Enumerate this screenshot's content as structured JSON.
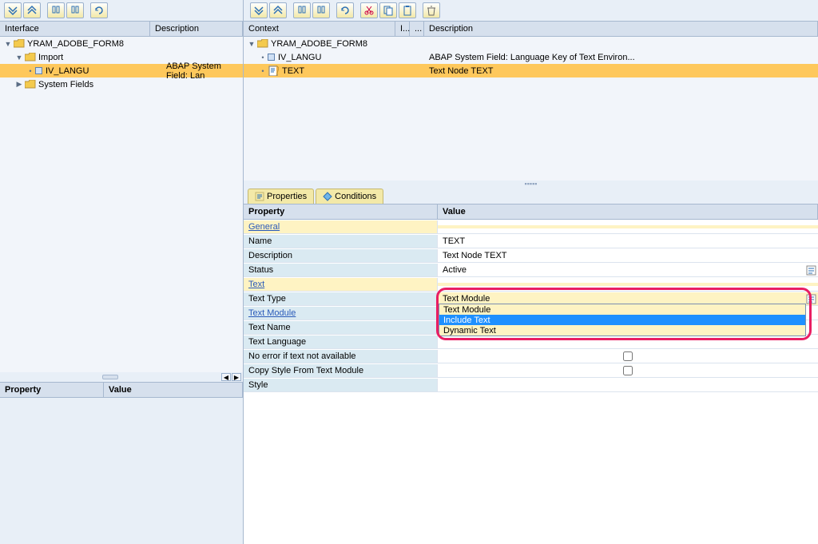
{
  "leftToolbar": {
    "tips": [
      "expand-all",
      "collapse-all",
      "find",
      "find-next",
      "refresh"
    ]
  },
  "rightToolbar": {
    "tips": [
      "expand-all",
      "collapse-all",
      "find",
      "find-next",
      "refresh",
      "cut",
      "copy",
      "paste",
      "delete"
    ]
  },
  "interfaceTree": {
    "headers": {
      "col1": "Interface",
      "col2": "Description"
    },
    "root": "YRAM_ADOBE_FORM8",
    "nodes": [
      {
        "label": "Import",
        "type": "folder",
        "indent": 1
      },
      {
        "label": "IV_LANGU",
        "type": "field",
        "indent": 2,
        "desc": "ABAP System Field: Lan",
        "selected": true
      },
      {
        "label": "System Fields",
        "type": "folder",
        "indent": 1
      }
    ]
  },
  "contextTree": {
    "headers": {
      "col1": "Context",
      "colI": "I...",
      "colS": "...",
      "colDesc": "Description"
    },
    "root": "YRAM_ADOBE_FORM8",
    "nodes": [
      {
        "label": "IV_LANGU",
        "type": "field",
        "indent": 1,
        "desc": "ABAP System Field: Language Key of Text Environ..."
      },
      {
        "label": "TEXT",
        "type": "doc",
        "indent": 1,
        "desc": "Text Node TEXT",
        "selected": true
      }
    ]
  },
  "tabs": [
    {
      "label": "Properties",
      "active": true,
      "icon": "props"
    },
    {
      "label": "Conditions",
      "active": false,
      "icon": "cond"
    }
  ],
  "propsHeaders": {
    "prop": "Property",
    "val": "Value"
  },
  "props": [
    {
      "kind": "section",
      "label": "General"
    },
    {
      "kind": "row",
      "label": "Name",
      "value": "TEXT"
    },
    {
      "kind": "row",
      "label": "Description",
      "value": "Text Node TEXT"
    },
    {
      "kind": "row",
      "label": "Status",
      "value": "Active",
      "valIcon": true
    },
    {
      "kind": "section",
      "label": "Text"
    },
    {
      "kind": "dropdown",
      "label": "Text Type",
      "value": "Text Module",
      "valIcon": true
    },
    {
      "kind": "linkrow",
      "label": "Text Module",
      "value": ""
    },
    {
      "kind": "row",
      "label": "Text Name",
      "value": ""
    },
    {
      "kind": "row",
      "label": "Text Language",
      "value": ""
    },
    {
      "kind": "check",
      "label": "No error if text not available",
      "checked": false
    },
    {
      "kind": "check",
      "label": "Copy Style From Text Module",
      "checked": false
    },
    {
      "kind": "row",
      "label": "Style",
      "value": ""
    }
  ],
  "dropdown": {
    "options": [
      "Text Module",
      "Include Text",
      "Dynamic Text"
    ],
    "selectedIndex": 0,
    "hoverIndex": 1
  },
  "bottomPanel": {
    "headers": {
      "prop": "Property",
      "val": "Value"
    }
  }
}
